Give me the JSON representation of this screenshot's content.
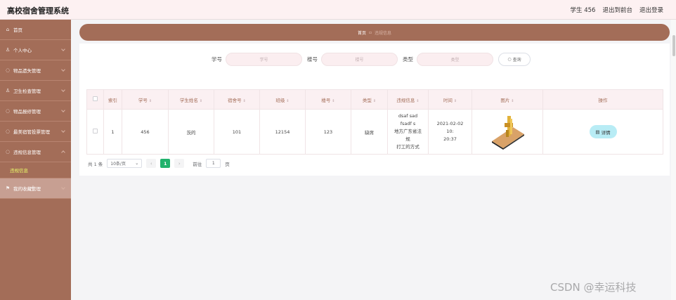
{
  "header": {
    "app_title": "高校宿舍管理系统",
    "user_label": "学生 456",
    "front_link": "退出到前台",
    "logout_link": "退出登录"
  },
  "sidebar": {
    "items": [
      {
        "label": "首页",
        "icon": "home-icon"
      },
      {
        "label": "个人中心",
        "icon": "user-icon"
      },
      {
        "label": "物品遗失管理",
        "icon": "circle-icon"
      },
      {
        "label": "卫生检查管理",
        "icon": "person-icon"
      },
      {
        "label": "物品报修管理",
        "icon": "circle-icon"
      },
      {
        "label": "最美宿管投票管理",
        "icon": "circle-icon"
      },
      {
        "label": "违规信息管理",
        "icon": "circle-icon"
      }
    ],
    "sub_item": "违规信息",
    "collect_item": "我的收藏管理"
  },
  "breadcrumb": {
    "home": "首页",
    "current": "违规信息"
  },
  "search": {
    "student_no_label": "学号",
    "student_no_placeholder": "学号",
    "building_label": "楼号",
    "building_placeholder": "楼号",
    "type_label": "类型",
    "type_placeholder": "类型",
    "search_button": "查询"
  },
  "table": {
    "headers": [
      "索引",
      "学号",
      "学生姓名",
      "宿舍号",
      "班级",
      "楼号",
      "类型",
      "违规信息",
      "时间",
      "图片",
      "操作"
    ],
    "rows": [
      {
        "index": "1",
        "student_no": "456",
        "name": "茨的",
        "dorm": "101",
        "class": "12154",
        "building": "123",
        "type": "缺席",
        "violation_line1": "dsaf sad fsadf s",
        "violation_line2": "地方广东省法规",
        "violation_line3": "打工的方式",
        "time_line1": "2021-02-02 10:",
        "time_line2": "20:37",
        "detail_button": "详情"
      }
    ]
  },
  "pagination": {
    "total": "共 1 条",
    "page_size": "10条/页",
    "current_page": "1",
    "goto_label": "前往",
    "goto_value": "1",
    "page_suffix": "页"
  },
  "watermark": "CSDN @幸运科技",
  "colors": {
    "sidebar": "#a36d58",
    "header": "#fdf1f2",
    "active_page": "#23b26d",
    "detail_button": "#b8ecf5"
  }
}
